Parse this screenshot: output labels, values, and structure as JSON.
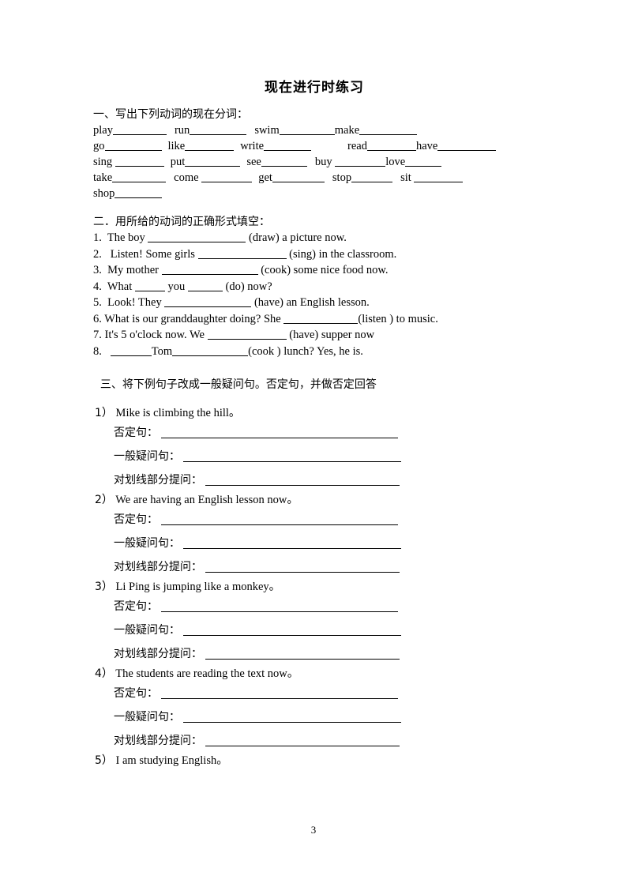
{
  "document": {
    "title": "现在进行时练习",
    "page_number": "3"
  },
  "section1": {
    "heading": "一、写出下列动词的现在分词：",
    "rows": [
      [
        {
          "word": "play",
          "blank": 68,
          "pre": 0
        },
        {
          "word": "run",
          "blank": 72,
          "pre": 10
        },
        {
          "word": "swim",
          "blank": 70,
          "pre": 10
        },
        {
          "word": "make",
          "blank": 73,
          "pre": 0
        }
      ],
      [
        {
          "word": "go",
          "blank": 72,
          "pre": 0
        },
        {
          "word": "like",
          "blank": 62,
          "pre": 8
        },
        {
          "word": "write",
          "blank": 60,
          "pre": 8
        },
        {
          "word": "read",
          "blank": 62,
          "pre": 46
        },
        {
          "word": "have",
          "blank": 74,
          "pre": 0
        }
      ],
      [
        {
          "word": "sing ",
          "blank": 62,
          "pre": 0
        },
        {
          "word": "put",
          "blank": 70,
          "pre": 8
        },
        {
          "word": "see",
          "blank": 58,
          "pre": 8
        },
        {
          "word": "buy ",
          "blank": 64,
          "pre": 10
        },
        {
          "word": "love",
          "blank": 46,
          "pre": 0
        }
      ],
      [
        {
          "word": "take",
          "blank": 68,
          "pre": 0
        },
        {
          "word": "come ",
          "blank": 64,
          "pre": 10
        },
        {
          "word": "get",
          "blank": 66,
          "pre": 8
        },
        {
          "word": "stop",
          "blank": 52,
          "pre": 10
        },
        {
          "word": "sit ",
          "blank": 62,
          "pre": 10
        }
      ],
      [
        {
          "word": "shop",
          "blank": 60,
          "pre": 0
        }
      ]
    ]
  },
  "section2": {
    "heading": "二．用所给的动词的正确形式填空：",
    "items": [
      {
        "num": "1.",
        "before": "  The boy ",
        "blank": 124,
        "after": " (draw) a picture now."
      },
      {
        "num": "2.",
        "before": "   Listen! Some girls ",
        "blank": 112,
        "after": " (sing) in the classroom."
      },
      {
        "num": "3.",
        "before": "  My mother ",
        "blank": 122,
        "after": " (cook) some nice food now."
      },
      {
        "num": "4.",
        "before": "  What ",
        "blank": 38,
        "mid": " you ",
        "blank2": 44,
        "after": " (do) now?"
      },
      {
        "num": "5.",
        "before": "  Look! They ",
        "blank": 110,
        "after": " (have) an English lesson."
      },
      {
        "num": "6.",
        "before": " What is our granddaughter doing? She ",
        "blank": 94,
        "after": "(listen ) to music."
      },
      {
        "num": "7.",
        "before": " It's 5 o'clock now. We ",
        "blank": 100,
        "after": " (have) supper now"
      },
      {
        "num": "8.",
        "before": "   ",
        "blank": 52,
        "mid": "Tom",
        "blank2": 96,
        "after": "(cook ) lunch? Yes, he is."
      }
    ]
  },
  "section3": {
    "heading": "  三、将下例句子改成一般疑问句。否定句，并做否定回答",
    "sub_labels": {
      "negative": "否定句：",
      "general_question": "一般疑问句：",
      "ask_underlined": "对划线部分提问："
    },
    "blank_widths": {
      "negative": 300,
      "general_question": 276,
      "ask_underlined": 246
    },
    "items": [
      {
        "num": "1）",
        "sentence": "Mike is climbing the hill。",
        "has_subs": true
      },
      {
        "num": "2）",
        "sentence": "We are having an English lesson now。",
        "has_subs": true
      },
      {
        "num": "3）",
        "sentence": "Li Ping is jumping like a monkey。",
        "has_subs": true
      },
      {
        "num": "4）",
        "sentence": "The students are reading the text now。",
        "has_subs": true
      },
      {
        "num": "5）",
        "sentence": "I am studying English。",
        "has_subs": false
      }
    ]
  }
}
